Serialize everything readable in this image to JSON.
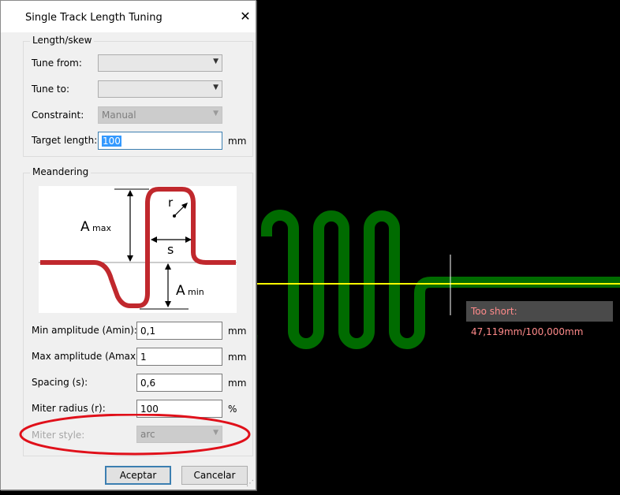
{
  "pcb": {
    "status_tooltip": "Too short: 47,119mm/100,000mm",
    "colors": {
      "background": "#000000",
      "trace": "#006b00",
      "guide": "#ffff00",
      "cursor": "#ffffff"
    }
  },
  "dialog": {
    "title": "Single Track Length Tuning",
    "close_glyph": "✕",
    "length_skew": {
      "heading": "Length/skew",
      "tune_from_label": "Tune from:",
      "tune_from_value": "",
      "tune_to_label": "Tune to:",
      "tune_to_value": "",
      "constraint_label": "Constraint:",
      "constraint_value": "Manual",
      "target_length_label": "Target length:",
      "target_length_value": "100",
      "target_length_unit": "mm"
    },
    "meandering": {
      "heading": "Meandering",
      "diagram_labels": {
        "amax": "A",
        "amax_sub": "max",
        "amin": "A",
        "amin_sub": "min",
        "spacing": "s",
        "radius": "r"
      },
      "min_amplitude_label": "Min amplitude (Amin):",
      "min_amplitude_value": "0,1",
      "min_amplitude_unit": "mm",
      "max_amplitude_label": "Max amplitude (Amax):",
      "max_amplitude_value": "1",
      "max_amplitude_unit": "mm",
      "spacing_label": "Spacing (s):",
      "spacing_value": "0,6",
      "spacing_unit": "mm",
      "miter_radius_label": "Miter radius (r):",
      "miter_radius_value": "100",
      "miter_radius_unit": "%",
      "miter_style_label": "Miter style:",
      "miter_style_value": "arc"
    },
    "buttons": {
      "ok": "Aceptar",
      "cancel": "Cancelar"
    }
  }
}
